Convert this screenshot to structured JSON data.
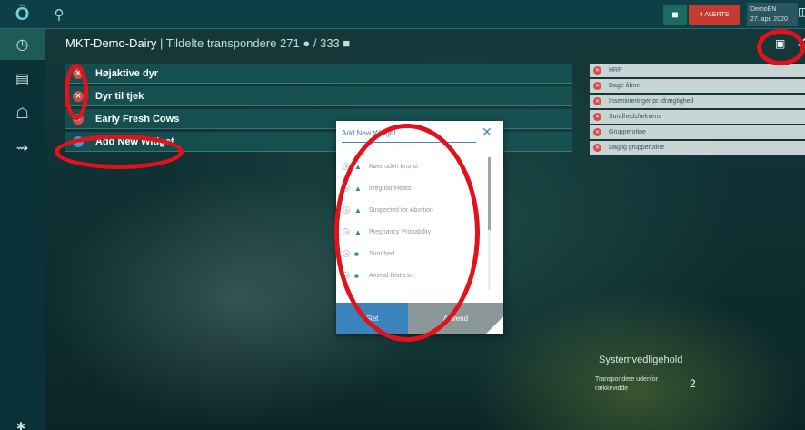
{
  "topbar": {
    "logo_glyph": "Ō",
    "alerts_label": "ALERTS",
    "alert_count": "4",
    "user_name": "DemoEN",
    "user_date": "27. apr. 2020"
  },
  "header": {
    "farm_name": "MKT-Demo-Dairy",
    "separator": " | ",
    "subtitle": "Tildelte transpondere",
    "transponder_count": "271",
    "total_label": "/ 333"
  },
  "widgets": [
    {
      "label": "Højaktive dyr"
    },
    {
      "label": "Dyr til tjek"
    },
    {
      "label": "Early Fresh Cows"
    }
  ],
  "add_widget_label": "Add New Widget",
  "right_widgets": [
    {
      "label": "HRP"
    },
    {
      "label": "Dage åbne"
    },
    {
      "label": "Insemineringer pr. drægtighed"
    },
    {
      "label": "Sundhedsfrekvens"
    },
    {
      "label": "Grupperutine"
    },
    {
      "label": "Daglig grupperutine"
    }
  ],
  "modal": {
    "title": "Add New Widget",
    "items": [
      {
        "label": "Køer uden brunst",
        "icon": "cow-icon"
      },
      {
        "label": "Irregular Heats",
        "icon": "cow-icon"
      },
      {
        "label": "Suspected for Abortion",
        "icon": "cow-icon"
      },
      {
        "label": "Pregnancy Probability",
        "icon": "cow-icon"
      },
      {
        "label": "Sundhed",
        "icon": "health-icon"
      },
      {
        "label": "Animal Distress",
        "icon": "health-icon"
      }
    ],
    "delete_label": "Slet",
    "apply_label": "Anvend"
  },
  "system": {
    "title": "Systemvedligehold",
    "label": "Transpondere udenfor rækkevidde",
    "value": "2"
  },
  "colors": {
    "accent": "#3f86c7",
    "remove": "#d74b4b",
    "annotation_ring": "#e1121b"
  }
}
